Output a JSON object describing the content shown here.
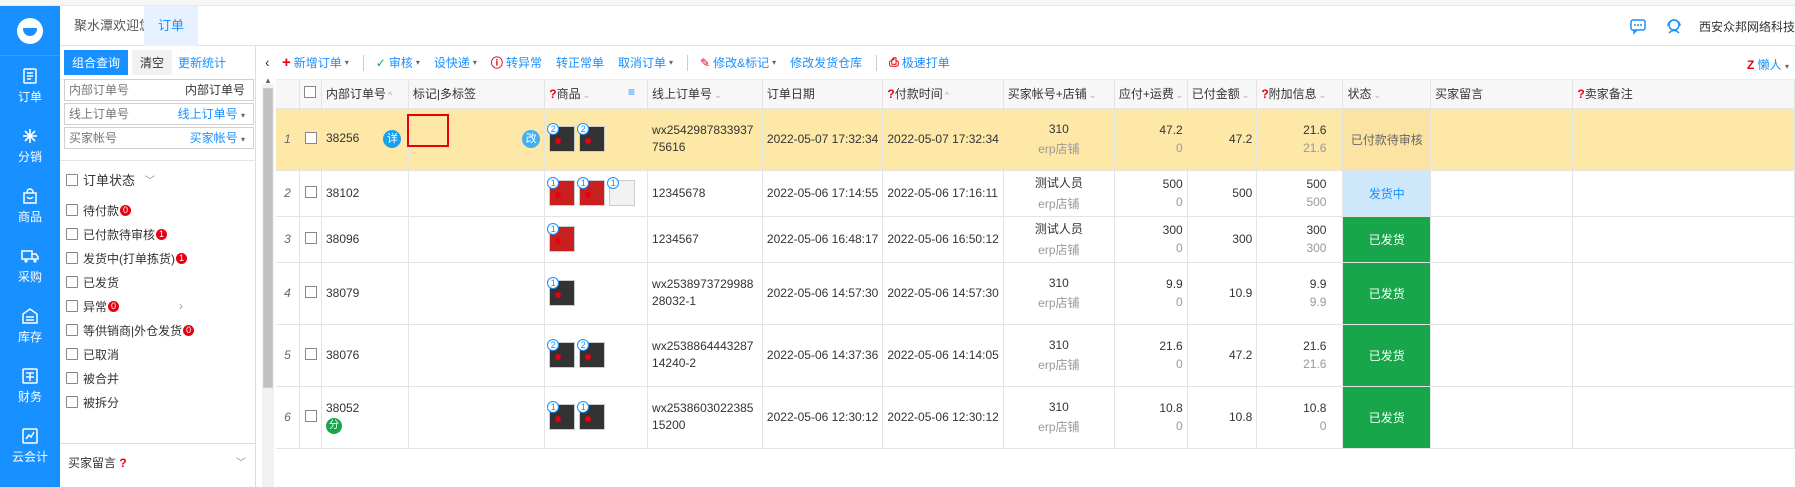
{
  "nav": {
    "items": [
      {
        "label": "订单",
        "icon": "order-icon"
      },
      {
        "label": "分销",
        "icon": "distribution-icon"
      },
      {
        "label": "商品",
        "icon": "product-icon"
      },
      {
        "label": "采购",
        "icon": "truck-icon"
      },
      {
        "label": "库存",
        "icon": "warehouse-icon"
      },
      {
        "label": "财务",
        "icon": "finance-icon"
      },
      {
        "label": "云会计",
        "icon": "accounting-icon"
      }
    ]
  },
  "tabs": {
    "welcome": "聚水潭欢迎您",
    "order": "订单"
  },
  "header": {
    "company": "西安众邦网络科技"
  },
  "filter": {
    "combo_query": "组合查询",
    "clear": "清空",
    "update_stats": "更新统计",
    "inner_order_placeholder": "内部订单号",
    "inner_order_option": "内部订单号",
    "online_order_placeholder": "线上订单号",
    "online_order_option": "线上订单号",
    "buyer_placeholder": "买家帐号",
    "buyer_option": "买家帐号",
    "status_title": "订单状态",
    "statuses": [
      {
        "label": "待付款",
        "badge": "0"
      },
      {
        "label": "已付款待审核",
        "badge": "1"
      },
      {
        "label": "发货中(打单拣货)",
        "badge": "1"
      },
      {
        "label": "已发货",
        "badge": ""
      },
      {
        "label": "异常",
        "badge": "0"
      },
      {
        "label": "等供销商|外仓发货",
        "badge": "0"
      },
      {
        "label": "已取消",
        "badge": ""
      },
      {
        "label": "被合并",
        "badge": ""
      },
      {
        "label": "被拆分",
        "badge": ""
      }
    ],
    "buyer_message": "买家留言"
  },
  "toolbar": {
    "new_order": "新增订单",
    "audit": "审核",
    "set_express": "设快递",
    "to_exception": "转异常",
    "to_normal": "转正常单",
    "cancel_order": "取消订单",
    "modify_mark": "修改&标记",
    "modify_warehouse": "修改发货仓库",
    "quick_print": "极速打单",
    "lazy": "懒人"
  },
  "columns": {
    "inner_no": "内部订单号",
    "mark": "标记|多标签",
    "goods": "商品",
    "online_no": "线上订单号",
    "order_date": "订单日期",
    "pay_time": "付款时间",
    "buyer_shop": "买家帐号+店铺",
    "payable": "应付+运费",
    "paid": "已付金额",
    "extra": "附加信息",
    "status": "状态",
    "buyer_msg": "买家留言",
    "seller_note": "卖家备注"
  },
  "rows": [
    {
      "idx": "1",
      "inner": "38256",
      "xiang": "详",
      "gai": "改",
      "goods": [
        {
          "n": "2",
          "c": "dark"
        },
        {
          "n": "2",
          "c": "dark"
        }
      ],
      "online": "wx254298783393775616",
      "odate": "2022-05-07 17:32:34",
      "ptime": "2022-05-07 17:32:34",
      "buyer": "310",
      "shop": "erp店铺",
      "pay": "47.2",
      "freight": "0",
      "paid": "47.2",
      "ex1": "21.6",
      "ex2": "21.6",
      "status": "已付款待审核",
      "stype": "audit"
    },
    {
      "idx": "2",
      "inner": "38102",
      "goods": [
        {
          "n": "1",
          "c": "red"
        },
        {
          "n": "1",
          "c": "red"
        },
        {
          "n": "1",
          "c": "light"
        }
      ],
      "online": "12345678",
      "odate": "2022-05-06 17:14:55",
      "ptime": "2022-05-06 17:16:11",
      "buyer": "测试人员",
      "shop": "erp店铺",
      "pay": "500",
      "freight": "0",
      "paid": "500",
      "ex1": "500",
      "ex2": "500",
      "status": "发货中",
      "stype": "sending"
    },
    {
      "idx": "3",
      "inner": "38096",
      "goods": [
        {
          "n": "1",
          "c": "red"
        }
      ],
      "online": "1234567",
      "odate": "2022-05-06 16:48:17",
      "ptime": "2022-05-06 16:50:12",
      "buyer": "测试人员",
      "shop": "erp店铺",
      "pay": "300",
      "freight": "0",
      "paid": "300",
      "ex1": "300",
      "ex2": "300",
      "status": "已发货",
      "stype": "sent"
    },
    {
      "idx": "4",
      "inner": "38079",
      "goods": [
        {
          "n": "1",
          "c": "dark"
        }
      ],
      "online": "wx253897372998828032-1",
      "odate": "2022-05-06 14:57:30",
      "ptime": "2022-05-06 14:57:30",
      "buyer": "310",
      "shop": "erp店铺",
      "pay": "9.9",
      "freight": "0",
      "paid": "10.9",
      "ex1": "9.9",
      "ex2": "9.9",
      "status": "已发货",
      "stype": "sent"
    },
    {
      "idx": "5",
      "inner": "38076",
      "goods": [
        {
          "n": "2",
          "c": "dark"
        },
        {
          "n": "2",
          "c": "dark"
        }
      ],
      "online": "wx253886444328714240-2",
      "odate": "2022-05-06 14:37:36",
      "ptime": "2022-05-06 14:14:05",
      "buyer": "310",
      "shop": "erp店铺",
      "pay": "21.6",
      "freight": "0",
      "paid": "47.2",
      "ex1": "21.6",
      "ex2": "21.6",
      "status": "已发货",
      "stype": "sent"
    },
    {
      "idx": "6",
      "inner": "38052",
      "fen": "分",
      "goods": [
        {
          "n": "1",
          "c": "dark"
        },
        {
          "n": "1",
          "c": "dark"
        }
      ],
      "online": "wx253860302238515200",
      "odate": "2022-05-06 12:30:12",
      "ptime": "2022-05-06 12:30:12",
      "buyer": "310",
      "shop": "erp店铺",
      "pay": "10.8",
      "freight": "0",
      "paid": "10.8",
      "ex1": "10.8",
      "ex2": "0",
      "status": "已发货",
      "stype": "sent"
    }
  ]
}
